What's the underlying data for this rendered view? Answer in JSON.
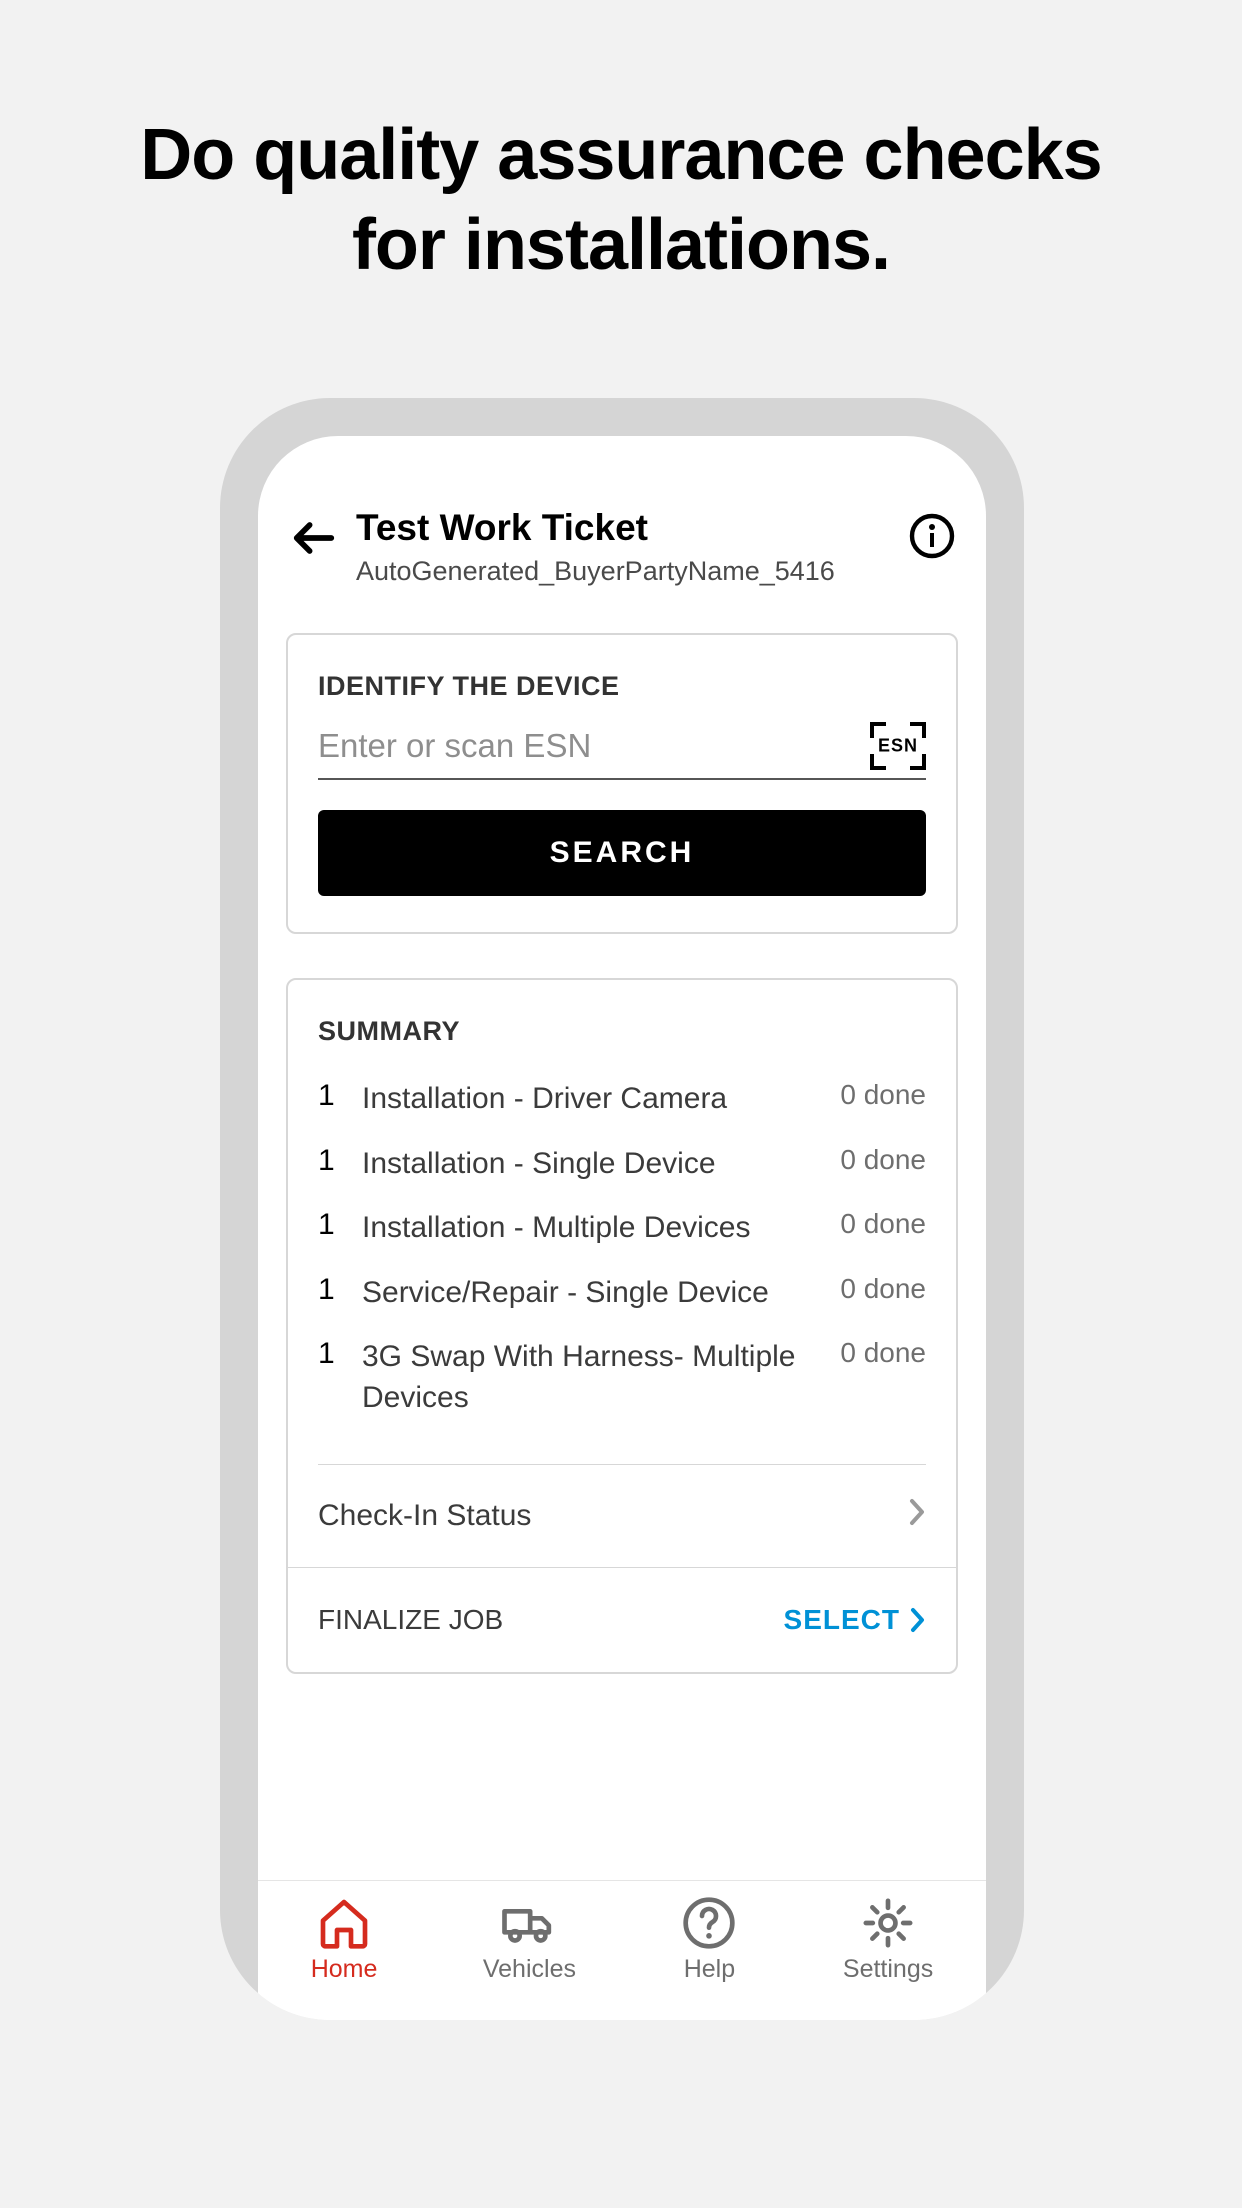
{
  "hero": {
    "title_line1": "Do quality assurance checks",
    "title_line2": "for installations."
  },
  "header": {
    "title": "Test Work Ticket",
    "subtitle": "AutoGenerated_BuyerPartyName_5416"
  },
  "identify": {
    "section_title": "IDENTIFY THE DEVICE",
    "placeholder": "Enter or scan ESN",
    "scan_label": "ESN",
    "search_label": "SEARCH"
  },
  "summary": {
    "section_title": "SUMMARY",
    "items": [
      {
        "count": "1",
        "label": "Installation - Driver Camera",
        "status": "0 done"
      },
      {
        "count": "1",
        "label": "Installation - Single Device",
        "status": "0 done"
      },
      {
        "count": "1",
        "label": "Installation - Multiple Devices",
        "status": "0 done"
      },
      {
        "count": "1",
        "label": "Service/Repair - Single Device",
        "status": "0 done"
      },
      {
        "count": "1",
        "label": "3G Swap With Harness- Multiple Devices",
        "status": "0 done"
      }
    ],
    "checkin_label": "Check-In Status",
    "finalize_label": "FINALIZE JOB",
    "finalize_action": "SELECT"
  },
  "nav": {
    "home": "Home",
    "vehicles": "Vehicles",
    "help": "Help",
    "settings": "Settings"
  }
}
